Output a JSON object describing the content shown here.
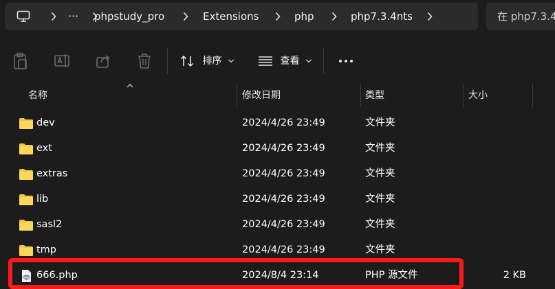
{
  "address_bar": {
    "crumbs": [
      "phpstudy_pro",
      "Extensions",
      "php",
      "php7.3.4nts"
    ],
    "more_label": "···"
  },
  "search": {
    "placeholder": "在 php7.3.4"
  },
  "toolbar": {
    "sort_label": "排序",
    "view_label": "查看",
    "more_label": "•••"
  },
  "columns": {
    "name": "名称",
    "date": "修改日期",
    "type": "类型",
    "size": "大小"
  },
  "files": [
    {
      "name": "dev",
      "date": "2024/4/26 23:49",
      "type": "文件夹",
      "size": "",
      "kind": "folder"
    },
    {
      "name": "ext",
      "date": "2024/4/26 23:49",
      "type": "文件夹",
      "size": "",
      "kind": "folder"
    },
    {
      "name": "extras",
      "date": "2024/4/26 23:49",
      "type": "文件夹",
      "size": "",
      "kind": "folder"
    },
    {
      "name": "lib",
      "date": "2024/4/26 23:49",
      "type": "文件夹",
      "size": "",
      "kind": "folder"
    },
    {
      "name": "sasl2",
      "date": "2024/4/26 23:49",
      "type": "文件夹",
      "size": "",
      "kind": "folder"
    },
    {
      "name": "tmp",
      "date": "2024/4/26 23:49",
      "type": "文件夹",
      "size": "",
      "kind": "folder"
    },
    {
      "name": "666.php",
      "date": "2024/8/4 23:14",
      "type": "PHP 源文件",
      "size": "2 KB",
      "kind": "php"
    }
  ],
  "colors": {
    "background": "#1c1c1c",
    "bar": "#2b2b2b",
    "folder": "#f4c542",
    "highlight": "#ff1a1a"
  }
}
